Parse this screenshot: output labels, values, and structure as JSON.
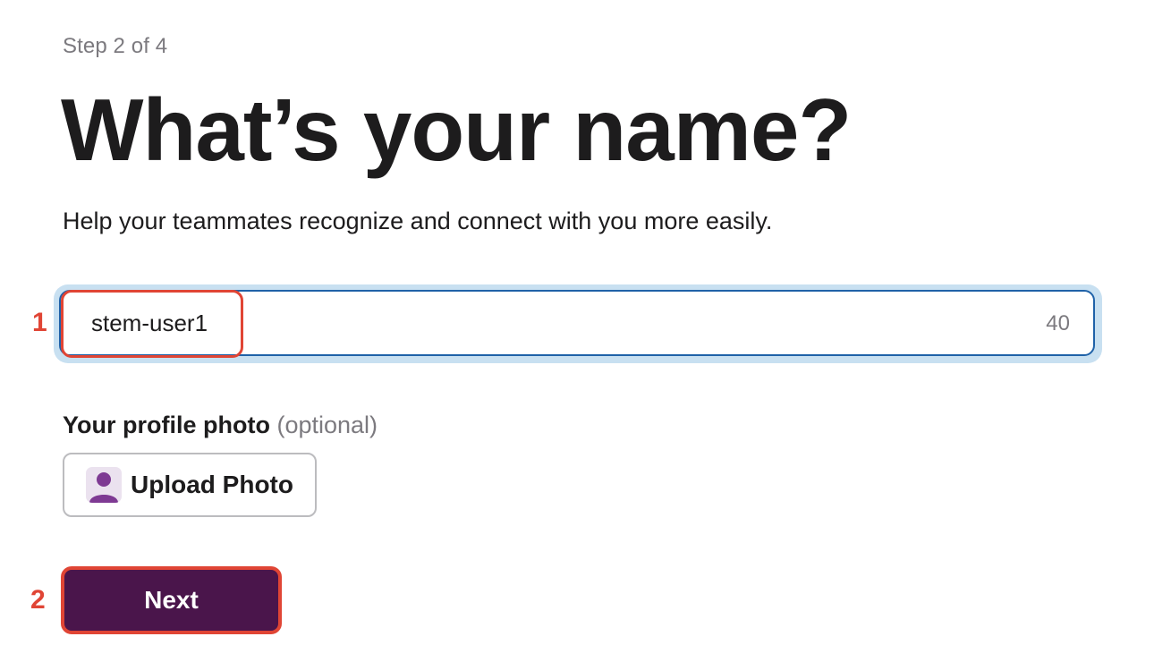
{
  "step": "Step 2 of 4",
  "title": "What’s your name?",
  "subtitle": "Help your teammates recognize and connect with you more easily.",
  "name_field": {
    "value": "stem-user1",
    "char_count": "40"
  },
  "profile_photo": {
    "label": "Your profile photo",
    "optional": "(optional)",
    "upload_label": "Upload Photo",
    "icon": "avatar-icon"
  },
  "next_label": "Next",
  "annotations": {
    "first": "1",
    "second": "2"
  },
  "colors": {
    "accent": "#4a154b",
    "annotation": "#e04535",
    "focus_ring": "#c8e0f1",
    "input_border": "#1f62a8",
    "muted": "#7c7a7f",
    "avatar": "#7e3a93"
  }
}
